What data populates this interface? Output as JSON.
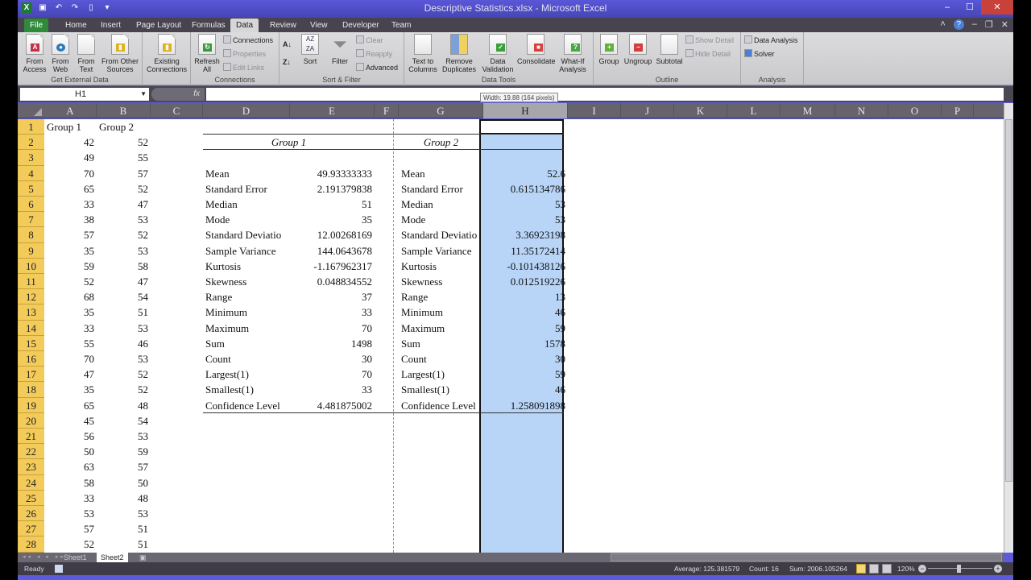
{
  "window": {
    "title": "Descriptive Statistics.xlsx - Microsoft Excel",
    "controls": [
      "minimize",
      "maximize",
      "close"
    ]
  },
  "ribbon_tabs": [
    {
      "label": "File"
    },
    {
      "label": "Home"
    },
    {
      "label": "Insert"
    },
    {
      "label": "Page Layout"
    },
    {
      "label": "Formulas"
    },
    {
      "label": "Data",
      "active": true
    },
    {
      "label": "Review"
    },
    {
      "label": "View"
    },
    {
      "label": "Developer"
    },
    {
      "label": "Team"
    }
  ],
  "ribbon": {
    "get_external_data": {
      "label": "Get External Data",
      "buttons": [
        "From Access",
        "From Web",
        "From Text",
        "From Other Sources"
      ]
    },
    "existing_connections": "Existing Connections",
    "connections": {
      "label": "Connections",
      "refresh_all": "Refresh All",
      "connections": "Connections",
      "properties": "Properties",
      "edit_links": "Edit Links"
    },
    "sort_filter": {
      "label": "Sort & Filter",
      "sort": "Sort",
      "filter": "Filter",
      "clear": "Clear",
      "reapply": "Reapply",
      "advanced": "Advanced"
    },
    "data_tools": {
      "label": "Data Tools",
      "text_to_columns": "Text to Columns",
      "remove_duplicates": "Remove Duplicates",
      "data_validation": "Data Validation",
      "consolidate": "Consolidate",
      "what_if": "What-If Analysis"
    },
    "outline": {
      "label": "Outline",
      "group": "Group",
      "ungroup": "Ungroup",
      "subtotal": "Subtotal",
      "show_detail": "Show Detail",
      "hide_detail": "Hide Detail"
    },
    "analysis": {
      "label": "Analysis",
      "data_analysis": "Data Analysis",
      "solver": "Solver"
    }
  },
  "formula_bar": {
    "name_box": "H1",
    "fx": "fx",
    "formula": ""
  },
  "tooltip": "Width: 19.88 (164 pixels)",
  "columns": [
    "A",
    "B",
    "C",
    "D",
    "E",
    "F",
    "G",
    "H",
    "I",
    "J",
    "K",
    "L",
    "M",
    "N",
    "O",
    "P"
  ],
  "rows": [
    "1",
    "2",
    "3",
    "4",
    "5",
    "6",
    "7",
    "8",
    "9",
    "10",
    "11",
    "12",
    "13",
    "14",
    "15",
    "16",
    "17",
    "18",
    "19",
    "20",
    "21",
    "22",
    "23",
    "24",
    "25",
    "26",
    "27",
    "28"
  ],
  "sheet": {
    "col_a_header": "Group 1",
    "col_b_header": "Group 2",
    "group1": [
      42,
      49,
      70,
      65,
      33,
      38,
      57,
      35,
      59,
      52,
      68,
      35,
      33,
      55,
      70,
      47,
      35,
      65,
      45,
      56,
      50,
      63,
      58,
      33,
      53,
      57,
      52
    ],
    "group2": [
      52,
      55,
      57,
      52,
      47,
      53,
      52,
      53,
      58,
      47,
      54,
      51,
      53,
      46,
      53,
      52,
      52,
      48,
      54,
      53,
      59,
      57,
      50,
      48,
      53,
      51,
      51
    ],
    "stats_labels": [
      "Mean",
      "Standard Error",
      "Median",
      "Mode",
      "Standard Deviatio",
      "Sample Variance",
      "Kurtosis",
      "Skewness",
      "Range",
      "Minimum",
      "Maximum",
      "Sum",
      "Count",
      "Largest(1)",
      "Smallest(1)",
      "Confidence Level"
    ],
    "stats_group1_title": "Group 1",
    "stats_group1_values": [
      "49.93333333",
      "2.191379838",
      "51",
      "35",
      "12.00268169",
      "144.0643678",
      "-1.167962317",
      "0.048834552",
      "37",
      "33",
      "70",
      "1498",
      "30",
      "70",
      "33",
      "4.481875002"
    ],
    "stats_group2_title": "Group 2",
    "stats_group2_values": [
      "52.6",
      "0.615134786",
      "53",
      "53",
      "3.36923198",
      "11.35172414",
      "-0.101438126",
      "0.012519226",
      "13",
      "46",
      "59",
      "1578",
      "30",
      "59",
      "46",
      "1.258091898"
    ]
  },
  "sheet_tabs": [
    {
      "label": "Sheet1"
    },
    {
      "label": "Sheet2",
      "active": true
    }
  ],
  "status": {
    "ready": "Ready",
    "average": "Average: 125.381579",
    "count": "Count: 16",
    "sum": "Sum: 2006.105264",
    "zoom": "120%"
  }
}
